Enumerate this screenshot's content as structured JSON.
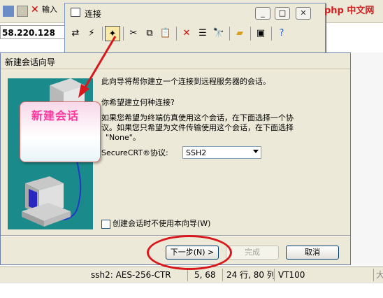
{
  "background": {
    "input_label": "输入",
    "address": "58.220.128"
  },
  "conn_window": {
    "title": "连接",
    "toolbar_icons": [
      "connect-icon",
      "quick-connect-icon",
      "new-session-icon",
      "cut-icon",
      "copy-icon",
      "paste-icon",
      "delete-icon",
      "properties-icon",
      "find-icon",
      "new-folder-icon",
      "connect-terminal-icon",
      "help-icon"
    ]
  },
  "wizard": {
    "title": "新建会话向导",
    "intro": "此向导将帮你建立一个连接到远程服务器的会话。",
    "question": "你希望建立何种连接?",
    "desc_line1": "如果您希望为终端仿真使用这个会话，在下面选择一个协",
    "desc_line2": "议。如果您只希望为文件传输使用这个会话，在下面选择",
    "desc_line3": "\"None\"。",
    "protocol_label": "SecureCRT®协议:",
    "protocol_value": "SSH2",
    "checkbox_label": "创建会话时不使用本向导(W)",
    "next_label": "下一步(N) >",
    "finish_label": "完成",
    "cancel_label": "取消"
  },
  "status_bar": {
    "cipher": "ssh2: AES-256-CTR",
    "position": "5,  68",
    "size": "24 行, 80 列",
    "terminal": "VT100",
    "extra": "大"
  },
  "annotation": {
    "callout": "新建会话"
  },
  "watermark": {
    "text": "php 中文网"
  },
  "colors": {
    "panel": "#1b8a8a",
    "highlight": "#d8181d",
    "callout_text": "#ff3aa0"
  }
}
